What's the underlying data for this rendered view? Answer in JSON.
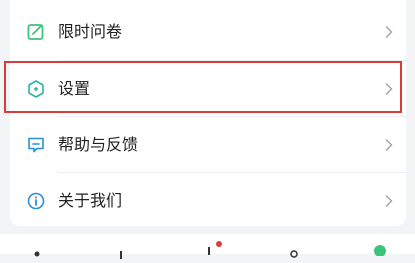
{
  "menu": {
    "items": [
      {
        "label": "限时问卷",
        "icon": "edit-square-icon"
      },
      {
        "label": "设置",
        "icon": "hexagon-settings-icon"
      },
      {
        "label": "帮助与反馈",
        "icon": "chat-feedback-icon"
      },
      {
        "label": "关于我们",
        "icon": "info-circle-icon"
      }
    ],
    "highlighted_index": 1
  },
  "colors": {
    "icon_green": "#3cc37a",
    "icon_teal": "#2ab5a8",
    "icon_blue": "#2a8fd6",
    "highlight_red": "#d63c3c",
    "chevron": "#a8a8a8"
  }
}
